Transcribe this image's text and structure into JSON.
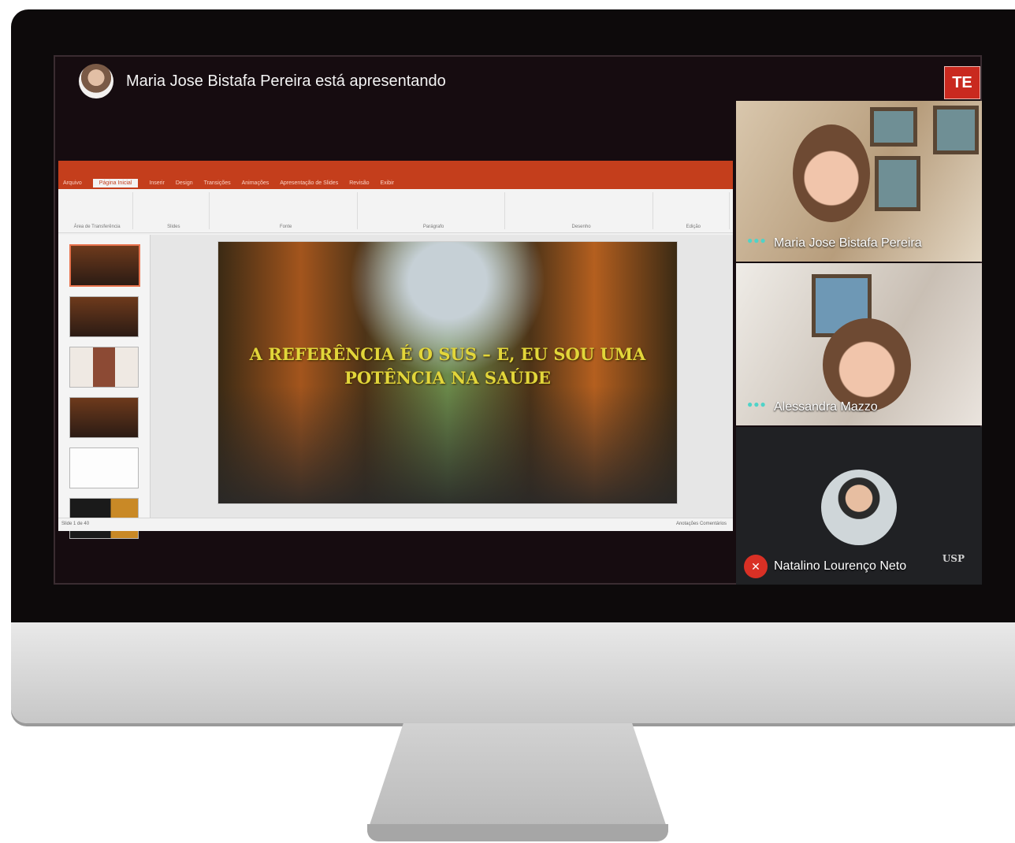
{
  "meet": {
    "presenter_text": "Maria Jose Bistafa Pereira está apresentando",
    "badge": "TE",
    "participants": [
      {
        "name": "Maria Jose Bistafa Pereira"
      },
      {
        "name": "Alessandra Mazzo"
      },
      {
        "name": "Natalino Lourenço Neto"
      }
    ],
    "logo_text": "USP"
  },
  "powerpoint": {
    "slide_title": "A REFERÊNCIA É O SUS – E, EU SOU UMA POTÊNCIA NA SAÚDE",
    "tabs": [
      "Arquivo",
      "Página Inicial",
      "Inserir",
      "Design",
      "Transições",
      "Animações",
      "Apresentação de Slides",
      "Revisão",
      "Exibir"
    ],
    "ribbon_groups": [
      "Área de Transferência",
      "Slides",
      "Fonte",
      "Parágrafo",
      "Desenho",
      "Edição"
    ],
    "status_left": "Slide 1 de 40",
    "status_right": "Anotações   Comentários"
  },
  "colors": {
    "ppt_accent": "#c43e1c",
    "meet_background": "#160c10",
    "speaking_dots": "#4fd3c8",
    "mic_muted": "#d93025"
  },
  "icons": [
    "mic-off-icon",
    "speaking-indicator-icon",
    "user-avatar-icon"
  ]
}
